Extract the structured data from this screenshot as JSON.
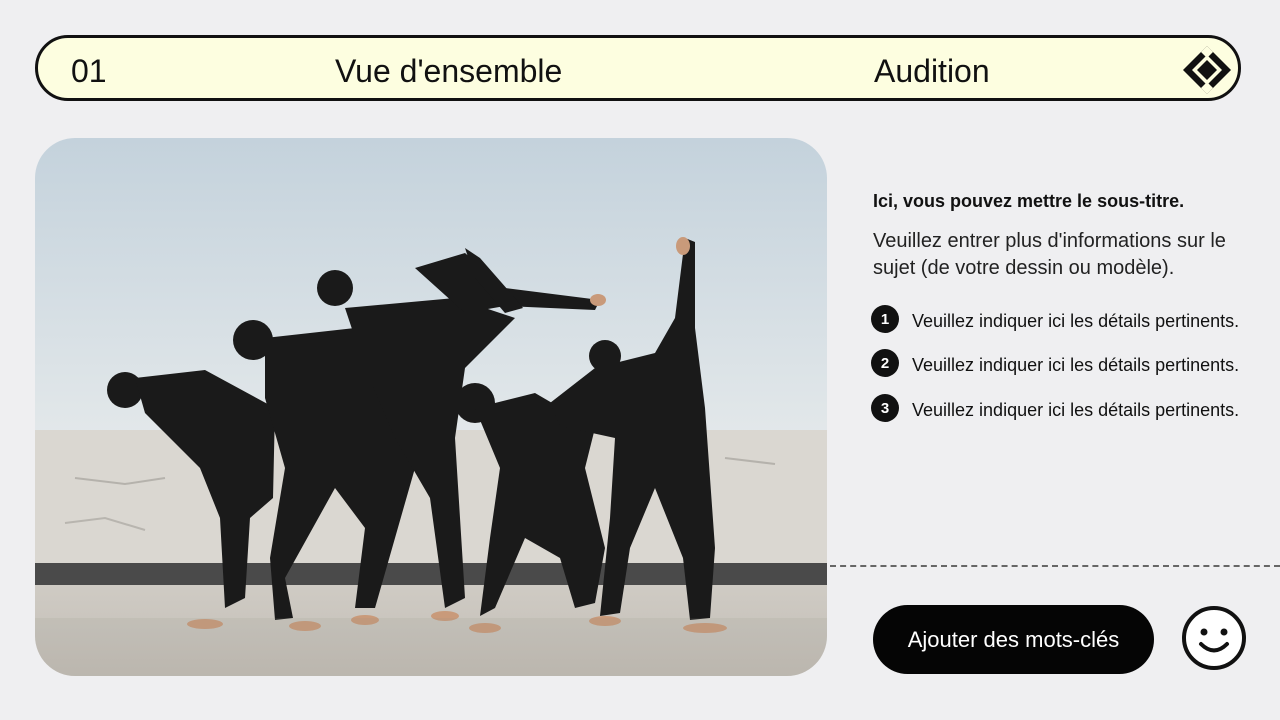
{
  "header": {
    "number": "01",
    "title": "Vue d'ensemble",
    "section": "Audition",
    "logo_icon": "diamond-logo-icon"
  },
  "photo": {
    "subject": "dancers-photo"
  },
  "content": {
    "subtitle": "Ici, vous pouvez mettre le sous-titre.",
    "description": "Veuillez entrer plus d'informations sur le sujet (de votre dessin ou modèle).",
    "items": [
      {
        "number": "1",
        "text": "Veuillez indiquer ici les détails pertinents."
      },
      {
        "number": "2",
        "text": "Veuillez indiquer ici les détails pertinents."
      },
      {
        "number": "3",
        "text": "Veuillez indiquer ici les détails pertinents."
      }
    ]
  },
  "footer": {
    "keywords_button": "Ajouter des mots-clés",
    "smiley_icon": "smiley-icon"
  },
  "colors": {
    "background": "#efeff1",
    "header_fill": "#fdfee0",
    "dark": "#111111"
  }
}
